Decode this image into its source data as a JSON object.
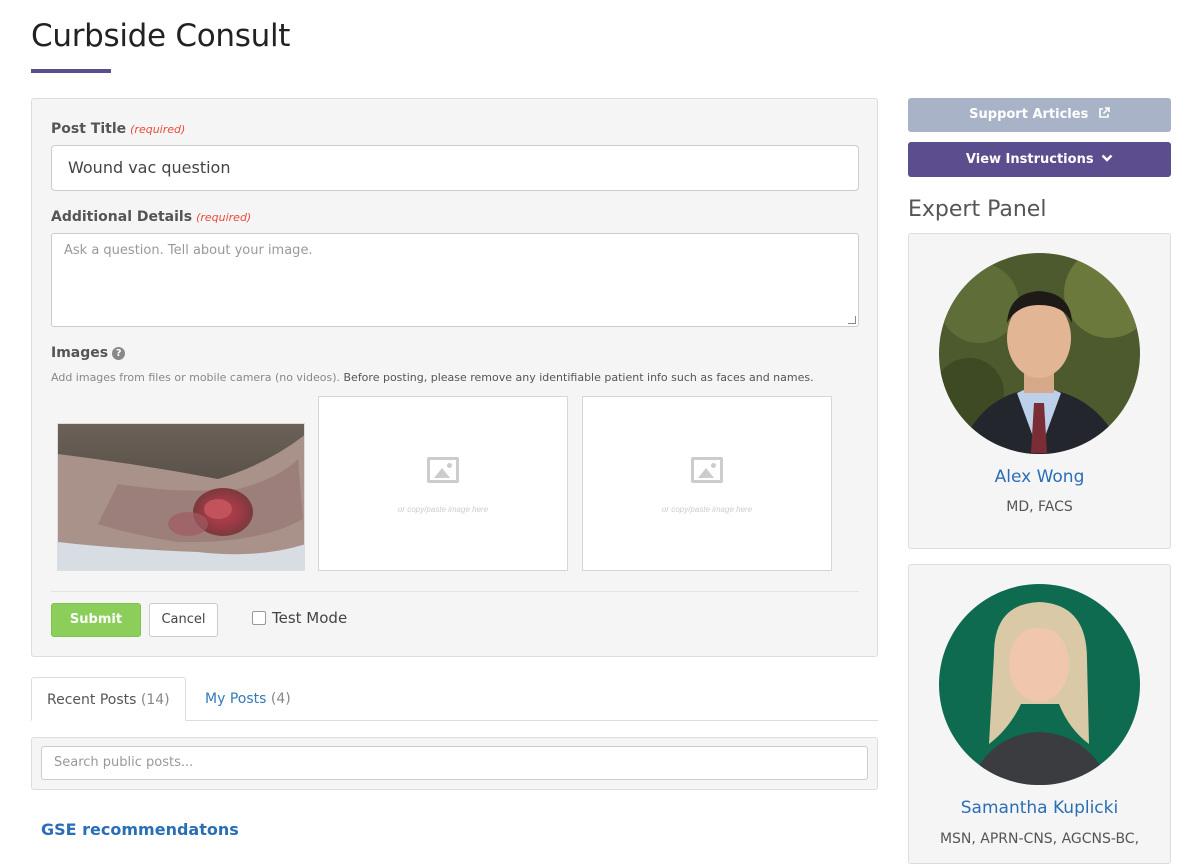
{
  "page": {
    "title": "Curbside Consult"
  },
  "form": {
    "post_title_label": "Post Title",
    "post_title_value": "Wound vac question",
    "required_text": "(required)",
    "details_label": "Additional Details",
    "details_placeholder": "Ask a question. Tell about your image.",
    "images_label": "Images",
    "images_hint_plain": "Add images from files or mobile camera (no videos).",
    "images_hint_bold": "Before posting, please remove any identifiable patient info such as faces and names.",
    "image_slot_text": "or copy/paste image here",
    "submit_label": "Submit",
    "cancel_label": "Cancel",
    "test_mode_label": "Test Mode"
  },
  "tabs": [
    {
      "label": "Recent Posts",
      "count": "(14)"
    },
    {
      "label": "My Posts",
      "count": "(4)"
    }
  ],
  "search": {
    "placeholder": "Search public posts..."
  },
  "posts": [
    {
      "title": "GSE recommendatons"
    }
  ],
  "sidebar": {
    "support_label": "Support Articles",
    "instructions_label": "View Instructions",
    "panel_heading": "Expert Panel",
    "experts": [
      {
        "name": "Alex Wong",
        "credentials": "MD, FACS"
      },
      {
        "name": "Samantha Kuplicki",
        "credentials": "MSN, APRN-CNS, AGCNS-BC,"
      }
    ]
  },
  "colors": {
    "accent": "#5b4d8e",
    "support_button": "#a9b3c8",
    "submit_button": "#8bcf5a",
    "link": "#2a6eb5",
    "required": "#e74c3c"
  },
  "icons": [
    "help-icon",
    "image-placeholder-icon",
    "external-link-icon",
    "chevron-down-icon"
  ]
}
